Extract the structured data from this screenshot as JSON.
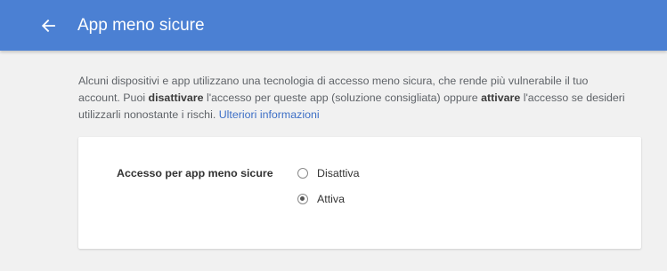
{
  "header": {
    "title": "App meno sicure",
    "back_icon": "arrow-left-icon"
  },
  "description": {
    "part1": "Alcuni dispositivi e app utilizzano una tecnologia di accesso meno sicura, che rende più vulnerabile il tuo account. Puoi ",
    "bold1": "disattivare",
    "part2": " l'accesso per queste app (soluzione consigliata) oppure ",
    "bold2": "attivare",
    "part3": " l'accesso se desideri utilizzarli nonostante i rischi. ",
    "link": "Ulteriori informazioni"
  },
  "setting": {
    "label": "Accesso per app meno sicure",
    "options": [
      {
        "label": "Disattiva",
        "selected": false
      },
      {
        "label": "Attiva",
        "selected": true
      }
    ]
  },
  "colors": {
    "header_bg": "#4b80d3",
    "link": "#3d6fc6",
    "page_bg": "#f1f1f1"
  }
}
